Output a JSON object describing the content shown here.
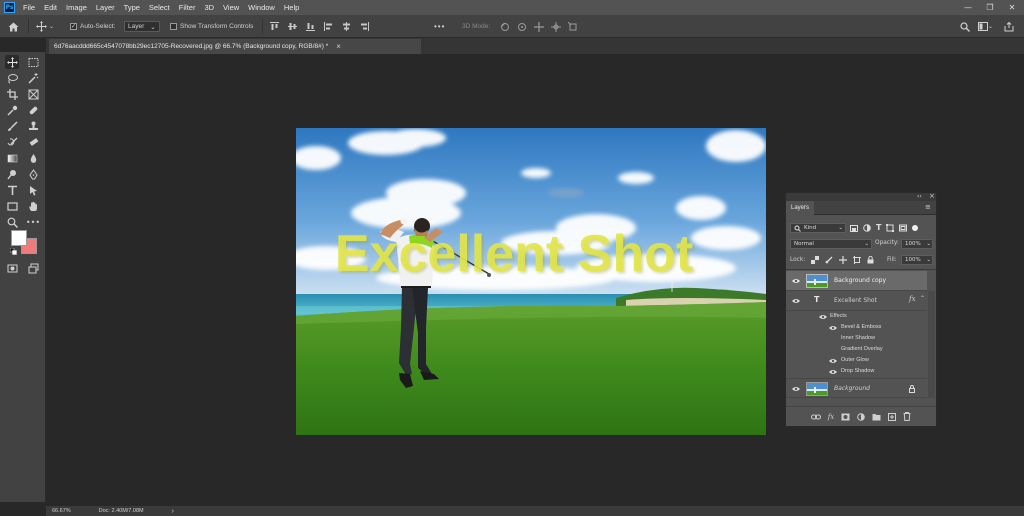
{
  "app": {
    "logo": "Ps",
    "menus": [
      "File",
      "Edit",
      "Image",
      "Layer",
      "Type",
      "Select",
      "Filter",
      "3D",
      "View",
      "Window",
      "Help"
    ],
    "window_controls": [
      "—",
      "❐",
      "✕"
    ]
  },
  "options_bar": {
    "auto_select_label": "Auto-Select:",
    "auto_select_checked": true,
    "auto_select_target": "Layer",
    "show_transform_label": "Show Transform Controls",
    "show_transform_checked": false,
    "mode_3d_label": "3D Mode:",
    "more_label": "•••"
  },
  "document_tab": {
    "title": "6d76aacddd665c4547078bb29ec12705-Recovered.jpg @ 66.7% (Background copy, RGB/8#) *",
    "close": "×"
  },
  "toolbar": {
    "foreground_color": "#ffffff",
    "background_color": "#ef7b7b",
    "more_tools": "•••"
  },
  "canvas": {
    "overlay_text": "Excellent Shot",
    "overlay_color": "#e2e64a"
  },
  "status_bar": {
    "zoom": "66.67%",
    "doc_info": "Doc: 2.40M/7.08M",
    "arrow": "›"
  },
  "layers_panel": {
    "title": "Layers",
    "filter_label": "Kind",
    "blend_mode": "Normal",
    "opacity_label": "Opacity:",
    "opacity_value": "100%",
    "lock_label": "Lock:",
    "fill_label": "Fill:",
    "fill_value": "100%",
    "layers": [
      {
        "name": "Background copy",
        "type": "image",
        "selected": true
      },
      {
        "name": "Excellent Shot",
        "type": "text",
        "fx": "fx"
      },
      {
        "name": "Background",
        "type": "image",
        "locked": true,
        "italic": true
      }
    ],
    "effects_label": "Effects",
    "effects": [
      {
        "name": "Bevel & Emboss",
        "visible": true
      },
      {
        "name": "Inner Shadow",
        "visible": false
      },
      {
        "name": "Gradient Overlay",
        "visible": false
      },
      {
        "name": "Outer Glow",
        "visible": true
      },
      {
        "name": "Drop Shadow",
        "visible": true
      }
    ],
    "text_layer_glyph": "T",
    "fx_glyph": "fx"
  }
}
